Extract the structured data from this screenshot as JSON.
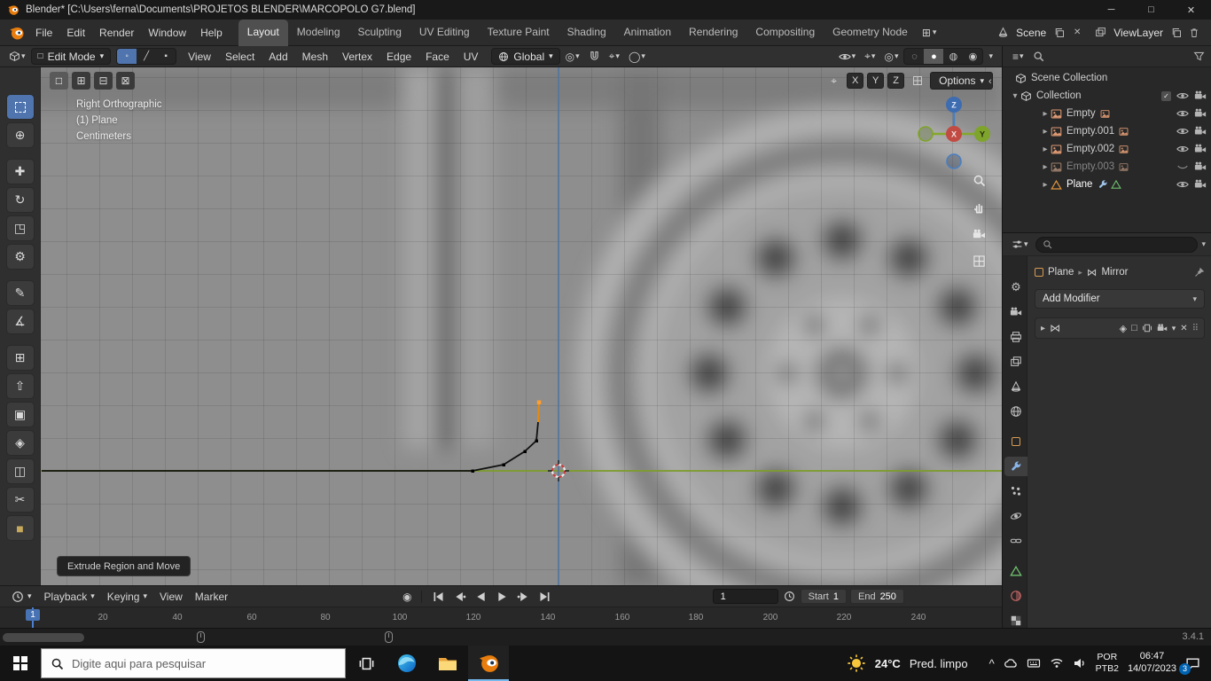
{
  "colors": {
    "accent_blue": "#4772b3",
    "object_orange": "#e8890c",
    "axis_x_red": "#c14b42",
    "axis_y_green": "#7fa42b",
    "axis_z_blue": "#3d6cb0",
    "viewport_gray": "#8e8e8e",
    "badge_blue": "#0063b1"
  },
  "icons": {
    "minimize": "─",
    "maximize": "□",
    "close": "✕",
    "chevron_down": "▾",
    "chevron_right": "▸",
    "chevron_left": "‹",
    "menu_lines": "≡",
    "workspace_add": "⊞",
    "sel_new": "□",
    "sel_extend": "⊞",
    "sel_subtract": "⊟",
    "sel_intersect": "⊠",
    "vertex_mode": "◦",
    "edge_mode": "╱",
    "face_mode": "▪",
    "pivot": "◎",
    "prop_edit": "◯",
    "snap_target": "⌖",
    "shade_wire": "◌",
    "shade_solid": "●",
    "shade_material": "◍",
    "shade_render": "◉",
    "overlay_toggle": "◎",
    "gizmo_toggle": "⌖",
    "record": "◉",
    "mirror": "⋈",
    "drag_handle": "⠿",
    "tool_cursor": "⊕",
    "tool_move": "✚",
    "tool_rotate": "↻",
    "tool_scale": "◳",
    "tool_transform": "⚙",
    "tool_annotate": "✎",
    "tool_measure": "∡",
    "tool_add_cube": "⊞",
    "tool_extrude": "⇧",
    "tool_inset": "▣",
    "tool_bevel": "◈",
    "tool_loop_cut": "◫",
    "tool_knife": "✂",
    "tool_poly_build": "■",
    "toggle_cage": "◈",
    "toggle_edit": "□",
    "tray_chevron": "^",
    "checkmark": "✓"
  },
  "title_bar": {
    "title": "Blender* [C:\\Users\\ferna\\Documents\\PROJETOS BLENDER\\MARCOPOLO G7.blend]"
  },
  "top_bar": {
    "menus": [
      "File",
      "Edit",
      "Render",
      "Window",
      "Help"
    ],
    "workspaces": [
      "Layout",
      "Modeling",
      "Sculpting",
      "UV Editing",
      "Texture Paint",
      "Shading",
      "Animation",
      "Rendering",
      "Compositing",
      "Geometry Node"
    ],
    "scene": "Scene",
    "view_layer": "ViewLayer"
  },
  "viewport_header": {
    "mode": "Edit Mode",
    "menus": [
      "View",
      "Select",
      "Add",
      "Mesh",
      "Vertex",
      "Edge",
      "Face",
      "UV"
    ],
    "orientation": "Global"
  },
  "tool_settings": {
    "x": "X",
    "y": "Y",
    "z": "Z",
    "options": "Options"
  },
  "viewport": {
    "line1": "Right Orthographic",
    "line2": "(1) Plane",
    "line3": "Centimeters",
    "operator": "Extrude Region and Move",
    "axis_x": "X",
    "axis_y": "Y",
    "axis_z": "Z"
  },
  "timeline": {
    "menus": [
      "Playback",
      "Keying",
      "View",
      "Marker"
    ],
    "current_frame": "1",
    "playhead": "1",
    "start_label": "Start",
    "start_value": "1",
    "end_label": "End",
    "end_value": "250",
    "ticks": [
      "20",
      "40",
      "60",
      "80",
      "100",
      "120",
      "140",
      "160",
      "180",
      "200",
      "220",
      "240"
    ]
  },
  "outliner": {
    "rows": [
      {
        "label": "Scene Collection",
        "eye": "none"
      },
      {
        "label": "Collection",
        "eye": "open",
        "checkbox": true
      },
      {
        "label": "Empty",
        "eye": "open"
      },
      {
        "label": "Empty.001",
        "eye": "open"
      },
      {
        "label": "Empty.002",
        "eye": "open"
      },
      {
        "label": "Empty.003",
        "eye": "closed"
      },
      {
        "label": "Plane",
        "eye": "open"
      }
    ]
  },
  "properties": {
    "object": "Plane",
    "modifier": "Mirror",
    "add_modifier": "Add Modifier"
  },
  "status_bar": {
    "version": "3.4.1"
  },
  "taskbar": {
    "search_placeholder": "Digite aqui para pesquisar",
    "temp": "24°C",
    "weather": "Pred. limpo",
    "lang1": "POR",
    "lang2": "PTB2",
    "time": "06:47",
    "date": "14/07/2023",
    "badge": "3"
  }
}
